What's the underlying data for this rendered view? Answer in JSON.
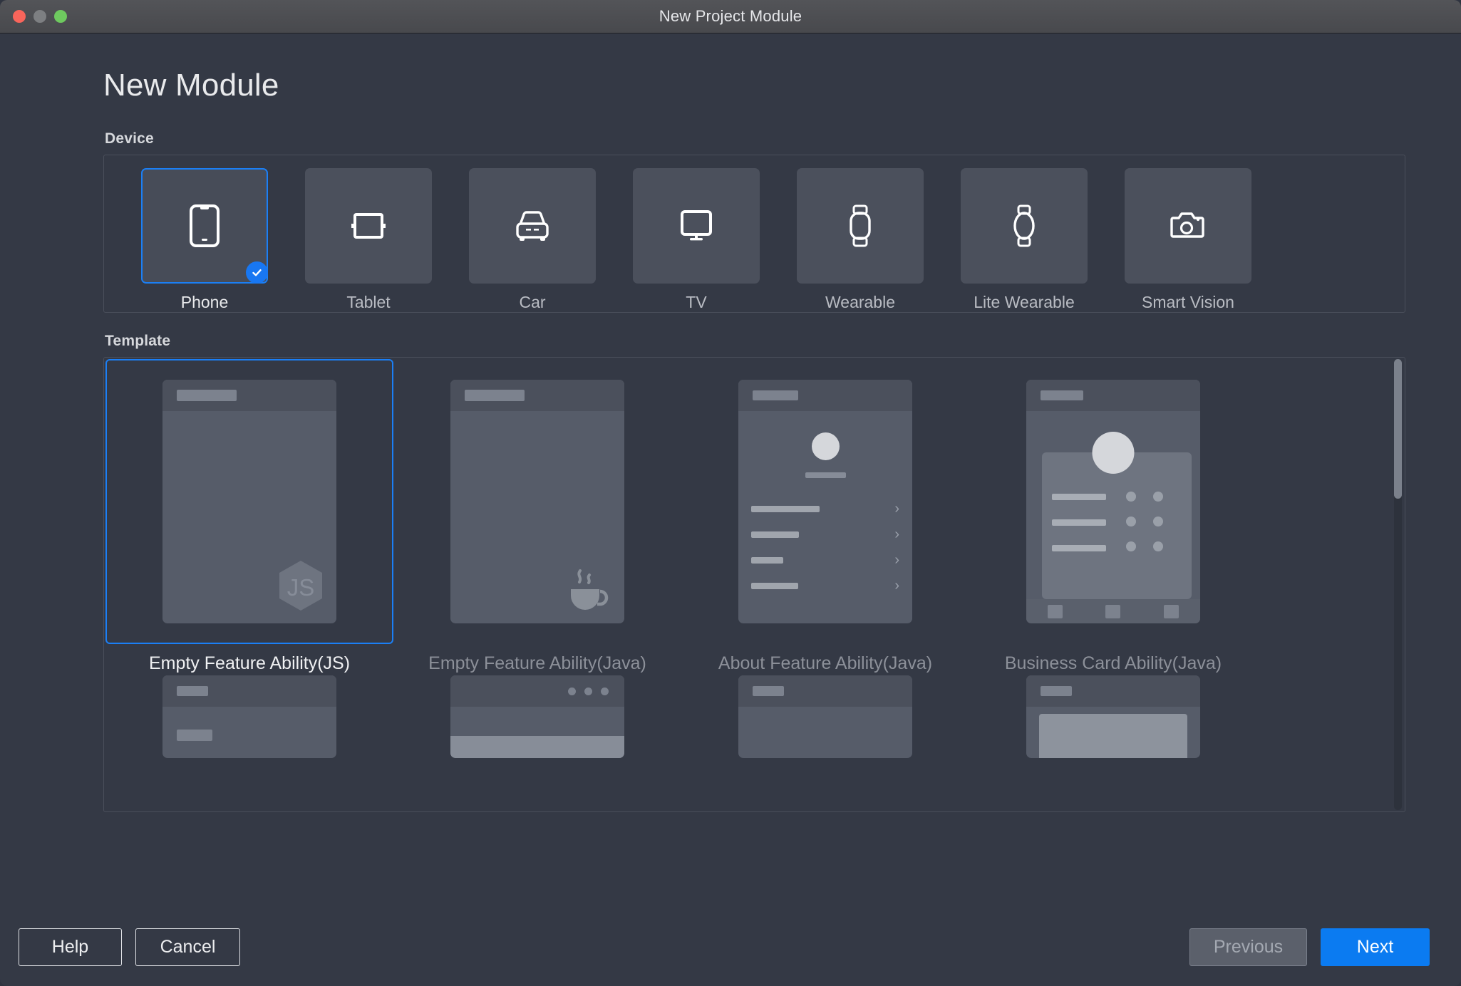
{
  "window": {
    "title": "New Project Module",
    "traffic_lights": [
      "close-button",
      "minimize-button",
      "maximize-button"
    ]
  },
  "page": {
    "heading": "New Module"
  },
  "device_section": {
    "label": "Device",
    "selected": "Phone",
    "items": [
      {
        "label": "Phone",
        "icon": "phone-icon",
        "selected": true
      },
      {
        "label": "Tablet",
        "icon": "tablet-icon",
        "selected": false
      },
      {
        "label": "Car",
        "icon": "car-icon",
        "selected": false
      },
      {
        "label": "TV",
        "icon": "tv-icon",
        "selected": false
      },
      {
        "label": "Wearable",
        "icon": "watch-icon",
        "selected": false
      },
      {
        "label": "Lite Wearable",
        "icon": "lite-watch-icon",
        "selected": false
      },
      {
        "label": "Smart Vision",
        "icon": "camera-icon",
        "selected": false
      }
    ]
  },
  "template_section": {
    "label": "Template",
    "selected": "Empty Feature Ability(JS)",
    "items": [
      {
        "label": "Empty Feature Ability(JS)",
        "badge": "js-logo",
        "selected": true
      },
      {
        "label": "Empty Feature Ability(Java)",
        "badge": "java-coffee",
        "selected": false
      },
      {
        "label": "About Feature Ability(Java)",
        "badge": "none",
        "selected": false
      },
      {
        "label": "Business Card Ability(Java)",
        "badge": "none",
        "selected": false
      }
    ],
    "scrollbar": {
      "thumb_percent": "31"
    }
  },
  "footer": {
    "help_label": "Help",
    "cancel_label": "Cancel",
    "previous_label": "Previous",
    "next_label": "Next"
  },
  "colors": {
    "accent": "#0b7bf1",
    "selection_border": "#1b7ff5",
    "dialog_bg": "#343945",
    "tile_bg": "#4b505c",
    "thumb_bg": "#565c69",
    "titlebar_bg": "#4d4e52"
  }
}
